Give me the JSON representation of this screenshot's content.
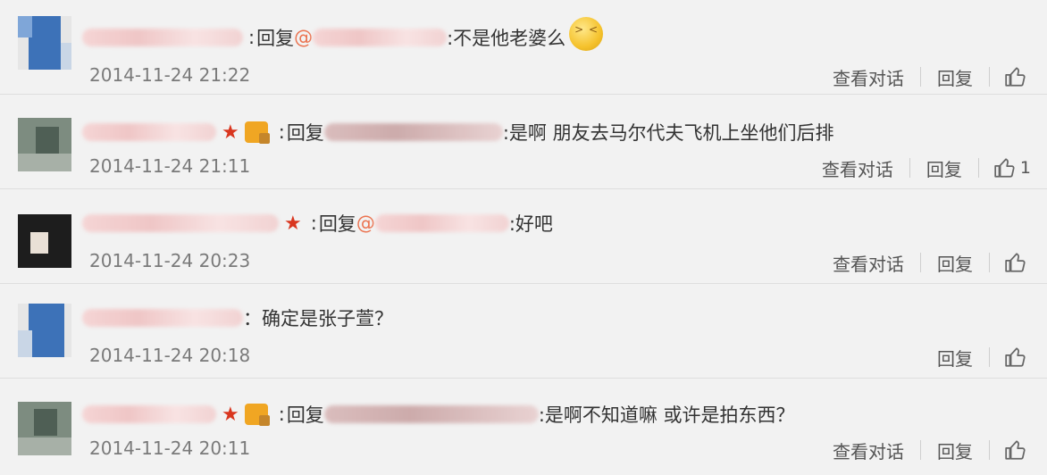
{
  "comments": [
    {
      "reply_prefix": "回复",
      "at": "@",
      "reply_text": ":不是他老婆么",
      "time": "2014-11-24 21:22",
      "actions": {
        "view": "查看对话",
        "reply": "回复",
        "like_count": ""
      }
    },
    {
      "reply_prefix": "回复",
      "reply_text": ":是啊 朋友去马尔代夫飞机上坐他们后排",
      "time": "2014-11-24 21:11",
      "actions": {
        "view": "查看对话",
        "reply": "回复",
        "like_count": "1"
      }
    },
    {
      "reply_prefix": "回复",
      "at": "@",
      "reply_text": ":好吧",
      "time": "2014-11-24 20:23",
      "actions": {
        "view": "查看对话",
        "reply": "回复",
        "like_count": ""
      }
    },
    {
      "reply_text": "：确定是张子萱？",
      "time": "2014-11-24 20:18",
      "actions": {
        "reply": "回复",
        "like_count": ""
      }
    },
    {
      "reply_prefix": "回复",
      "reply_text": ":是啊不知道嘛 或许是拍东西？",
      "time": "2014-11-24 20:11",
      "actions": {
        "view": "查看对话",
        "reply": "回复",
        "like_count": ""
      }
    }
  ],
  "colors": {
    "mention": "#eb7350",
    "star": "#d9361f",
    "timestamp": "#7a7a7a"
  },
  "icons": [
    "thumbs-up-icon",
    "star-icon",
    "medal-icon",
    "emoji-icon"
  ]
}
